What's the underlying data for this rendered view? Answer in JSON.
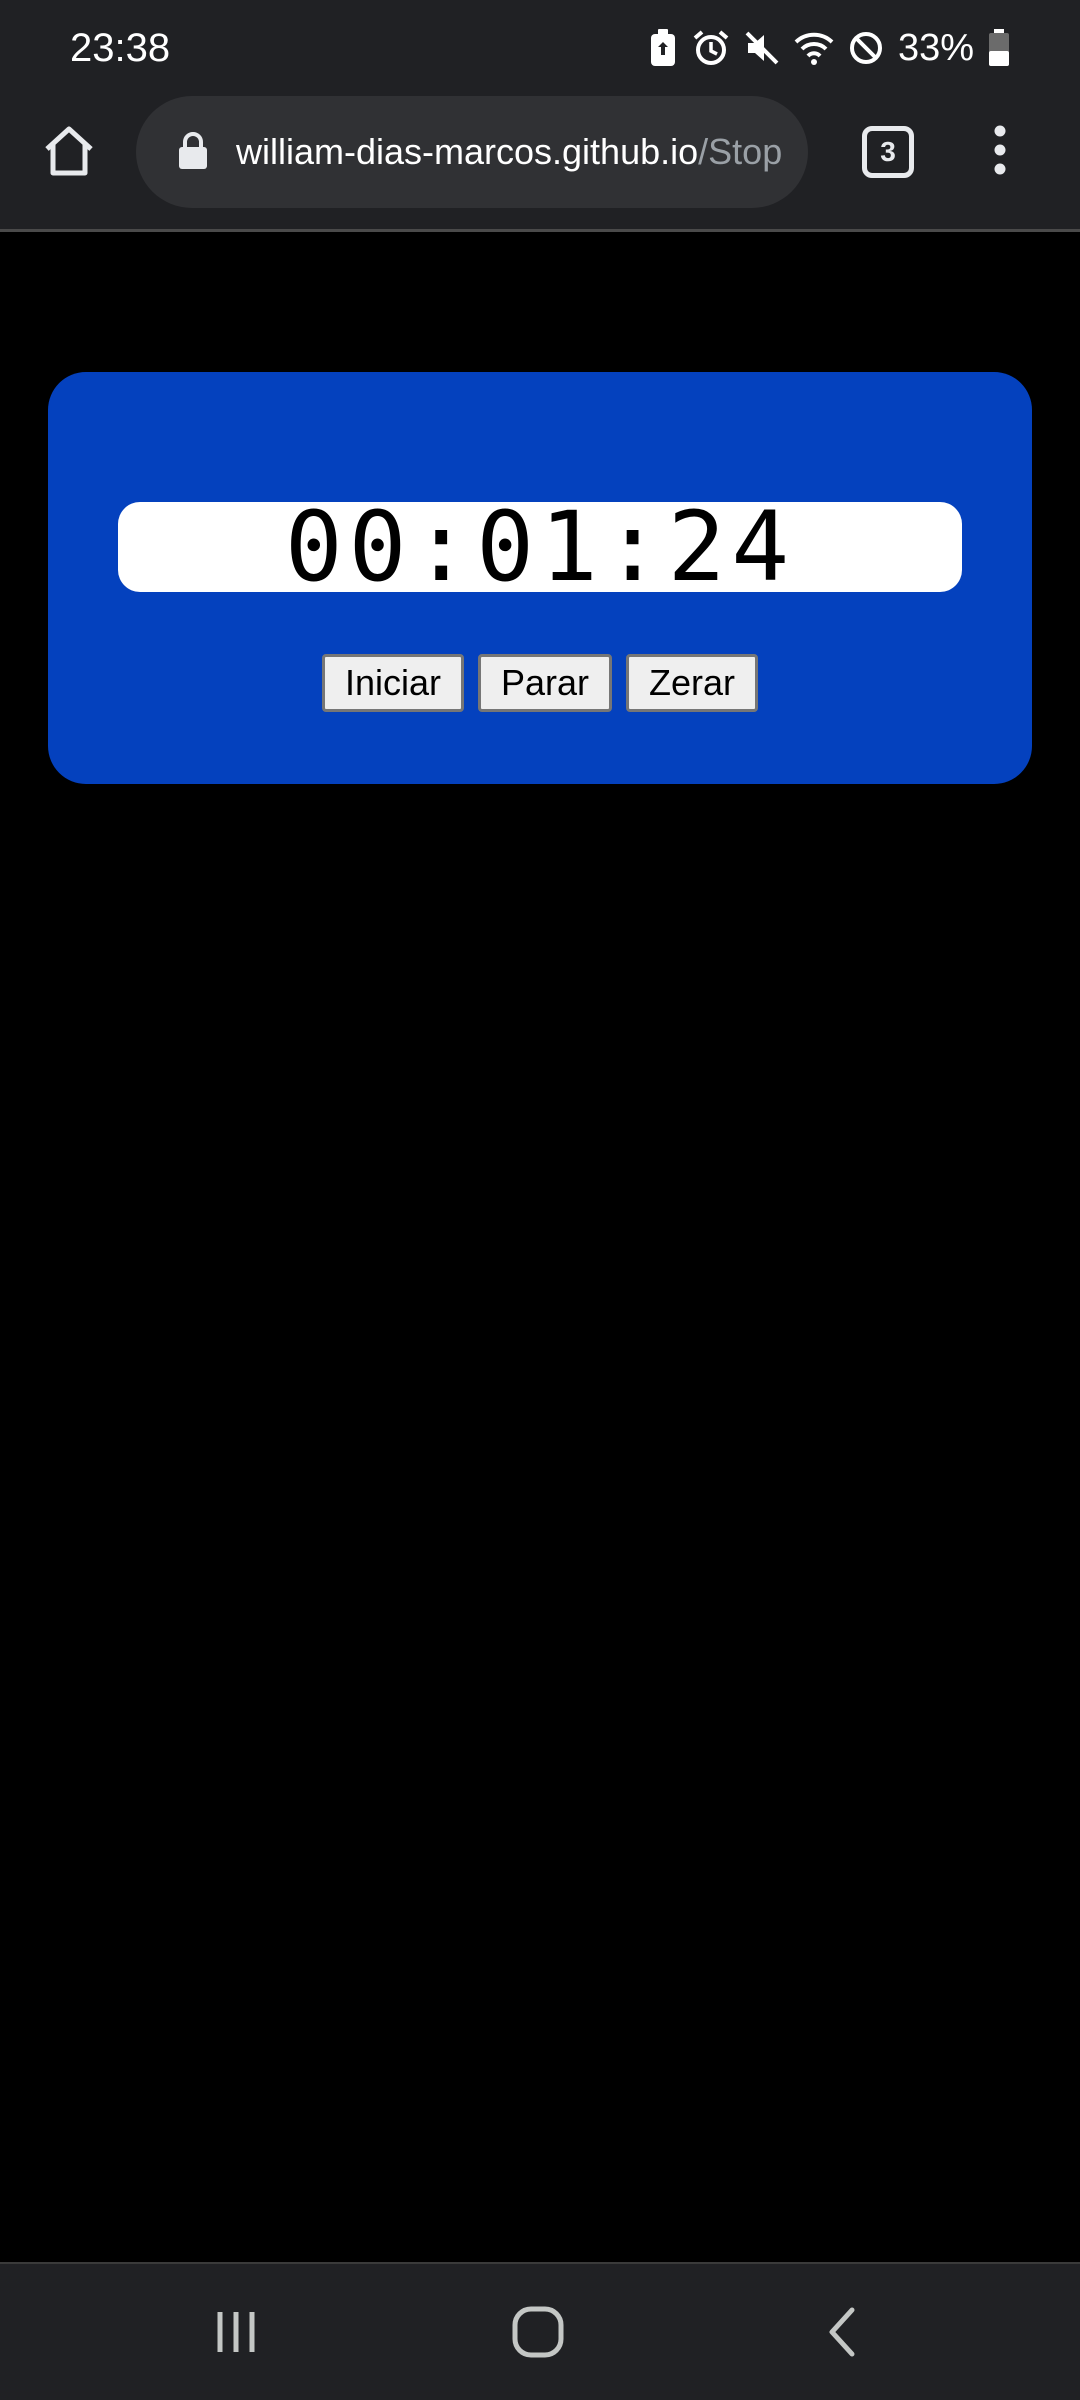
{
  "status_bar": {
    "time": "23:38",
    "battery_percent": "33%",
    "icons": [
      "battery-saver-icon",
      "alarm-icon",
      "mute-icon",
      "wifi-icon",
      "do-not-disturb-icon",
      "battery-icon"
    ]
  },
  "browser": {
    "url_host": "william-dias-marcos.github.io",
    "url_path": "/Stop",
    "tab_count": "3"
  },
  "stopwatch": {
    "time": "00:01:24",
    "start_label": "Iniciar",
    "stop_label": "Parar",
    "reset_label": "Zerar",
    "card_color": "#0441be"
  },
  "nav": {
    "icons": [
      "recent-apps-icon",
      "home-icon",
      "back-icon"
    ]
  }
}
